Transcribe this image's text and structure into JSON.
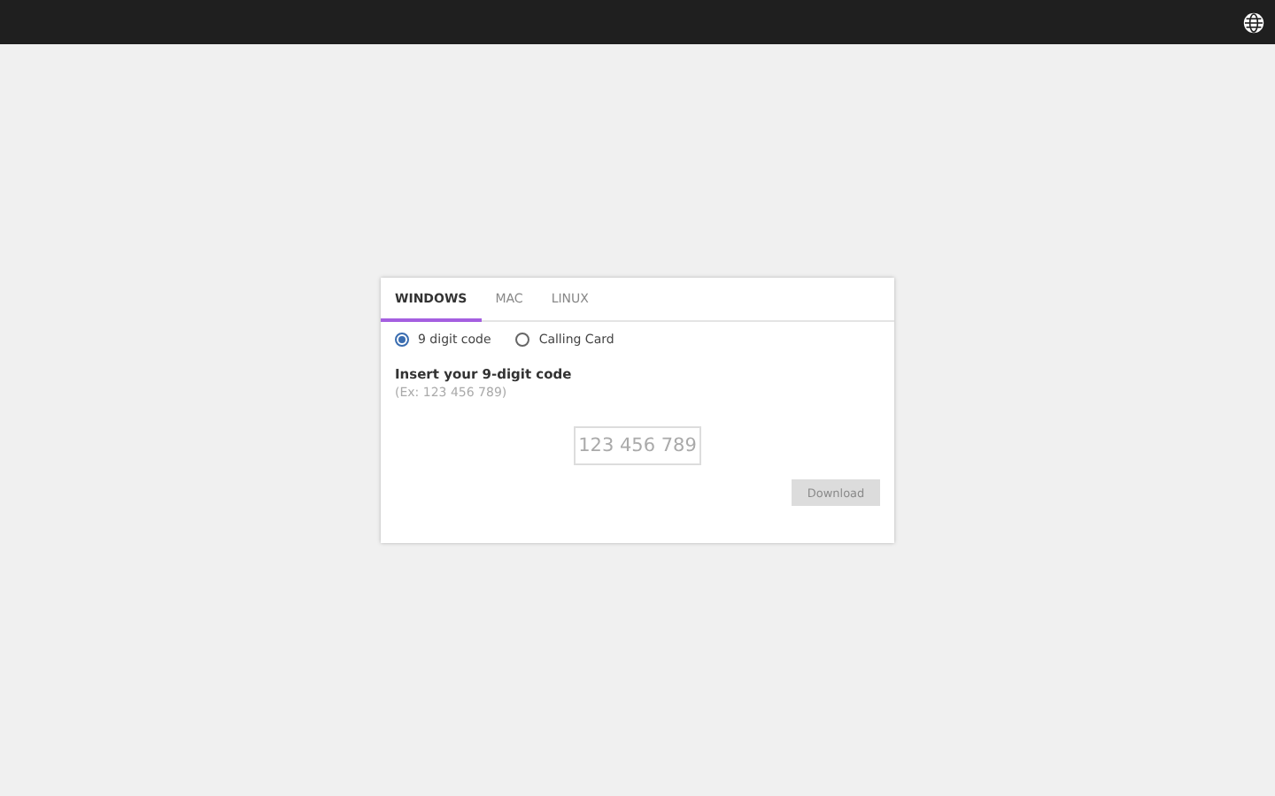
{
  "tabs": [
    {
      "label": "WINDOWS",
      "selected": true
    },
    {
      "label": "MAC",
      "selected": false
    },
    {
      "label": "LINUX",
      "selected": false
    }
  ],
  "options": [
    {
      "label": "9 digit code",
      "selected": true
    },
    {
      "label": "Calling Card",
      "selected": false
    }
  ],
  "heading": "Insert your 9-digit code",
  "example": "(Ex: 123 456 789)",
  "code_field": {
    "placeholder": "123 456 789"
  },
  "download_button": {
    "label": "Download",
    "disabled": true
  }
}
